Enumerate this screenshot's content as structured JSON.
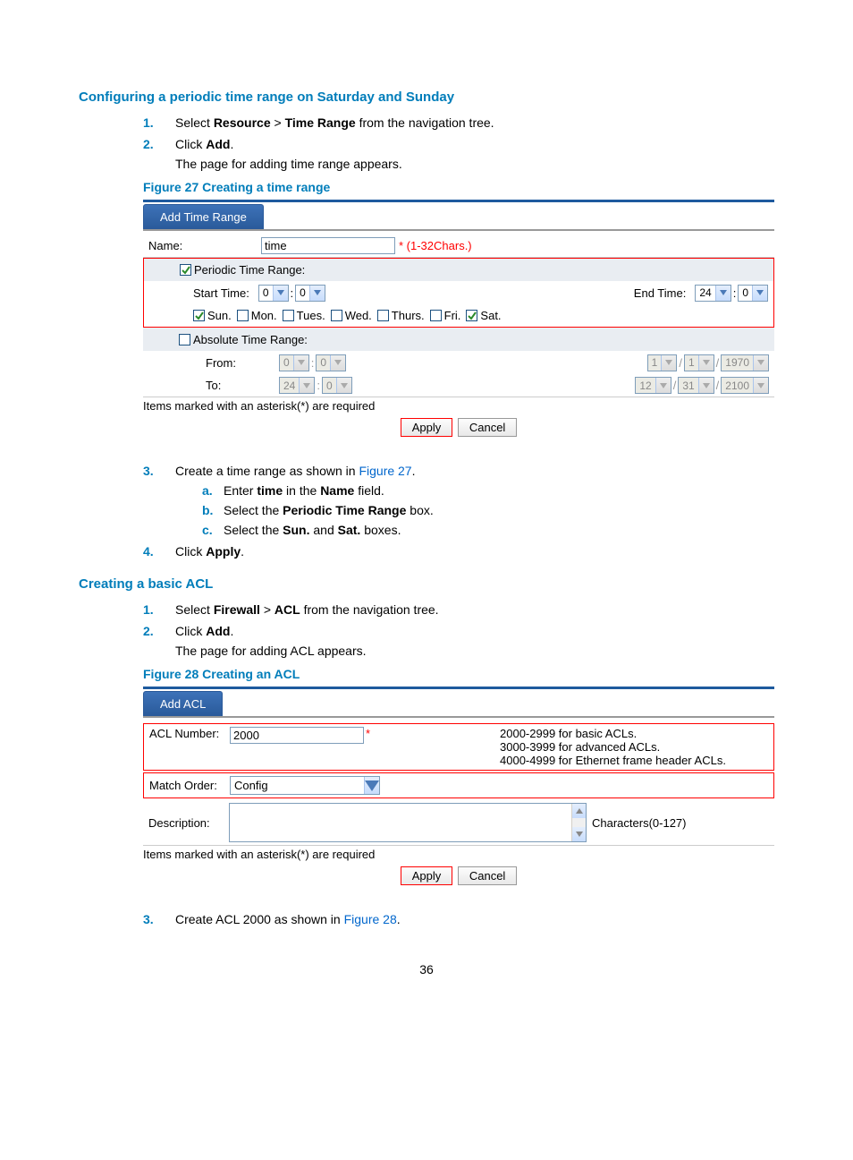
{
  "page_number": "36",
  "section1": {
    "heading": "Configuring a periodic time range on Saturday and Sunday",
    "steps": {
      "n1": "1.",
      "s1a": "Select ",
      "s1b": "Resource",
      "s1c": " > ",
      "s1d": "Time Range",
      "s1e": " from the navigation tree.",
      "n2": "2.",
      "s2a": "Click ",
      "s2b": "Add",
      "s2c": ".",
      "s2d": "The page for adding time range appears.",
      "figcap": "Figure 27 Creating a time range",
      "n3": "3.",
      "s3a": "Create a time range as shown in ",
      "s3link": "Figure 27",
      "s3b": ".",
      "sub_a_l": "a.",
      "sub_a1": "Enter ",
      "sub_a2": "time",
      "sub_a3": " in the ",
      "sub_a4": "Name",
      "sub_a5": " field.",
      "sub_b_l": "b.",
      "sub_b1": "Select the ",
      "sub_b2": "Periodic Time Range",
      "sub_b3": " box.",
      "sub_c_l": "c.",
      "sub_c1": "Select the ",
      "sub_c2": "Sun.",
      "sub_c3": " and ",
      "sub_c4": "Sat.",
      "sub_c5": " boxes.",
      "n4": "4.",
      "s4a": "Click ",
      "s4b": "Apply",
      "s4c": "."
    }
  },
  "fig27": {
    "tab": "Add Time Range",
    "name_label": "Name:",
    "name_value": "time",
    "name_hint": "* (1-32Chars.)",
    "periodic_box_label": "Periodic Time Range:",
    "start_time_label": "Start Time:",
    "start_h": "0",
    "start_m": "0",
    "end_time_label": "End Time:",
    "end_h": "24",
    "end_m": "0",
    "days": {
      "sun": "Sun.",
      "mon": "Mon.",
      "tue": "Tues.",
      "wed": "Wed.",
      "thu": "Thurs.",
      "fri": "Fri.",
      "sat": "Sat."
    },
    "absolute_label": "Absolute Time Range:",
    "from_label": "From:",
    "from_h": "0",
    "from_m": "0",
    "from_d": "1",
    "from_mo": "1",
    "from_y": "1970",
    "to_label": "To:",
    "to_h": "24",
    "to_m": "0",
    "to_d": "12",
    "to_mo": "31",
    "to_y": "2100",
    "footnote": "Items marked with an asterisk(*) are required",
    "apply": "Apply",
    "cancel": "Cancel"
  },
  "section2": {
    "heading": "Creating a basic ACL",
    "n1": "1.",
    "s1a": "Select ",
    "s1b": "Firewall",
    "s1c": " > ",
    "s1d": "ACL",
    "s1e": " from the navigation tree.",
    "n2": "2.",
    "s2a": "Click ",
    "s2b": "Add",
    "s2c": ".",
    "s2d": "The page for adding ACL appears.",
    "figcap": "Figure 28 Creating an ACL",
    "n3": "3.",
    "s3a": "Create ACL 2000 as shown in ",
    "s3link": "Figure 28",
    "s3b": "."
  },
  "fig28": {
    "tab": "Add ACL",
    "acl_number_label": "ACL Number:",
    "acl_number_value": "2000",
    "help1": "2000-2999 for basic ACLs.",
    "help2": "3000-3999 for advanced ACLs.",
    "help3": "4000-4999 for Ethernet frame header ACLs.",
    "match_order_label": "Match Order:",
    "match_order_value": "Config",
    "description_label": "Description:",
    "desc_hint": "Characters(0-127)",
    "footnote": "Items marked with an asterisk(*) are required",
    "apply": "Apply",
    "cancel": "Cancel"
  }
}
